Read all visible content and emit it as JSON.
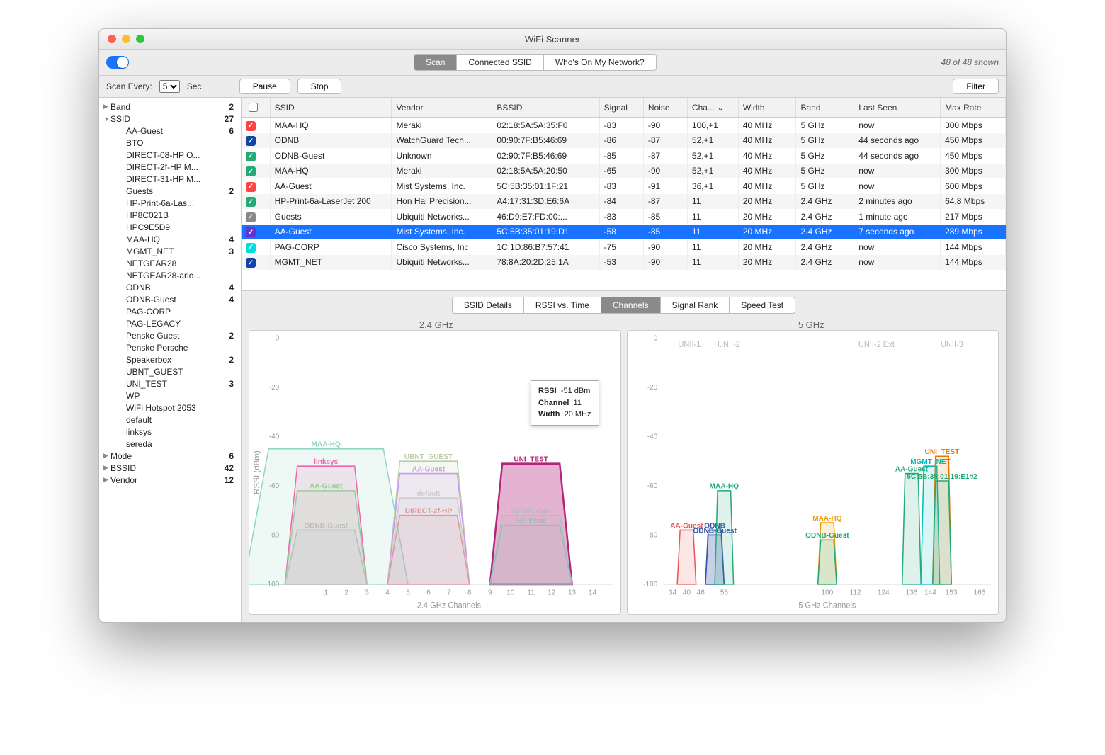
{
  "window": {
    "title": "WiFi Scanner"
  },
  "toolbar": {
    "tabs": [
      "Scan",
      "Connected SSID",
      "Who's On My Network?"
    ],
    "active_tab": 0,
    "shown_text": "48 of 48 shown"
  },
  "controls": {
    "scan_every_label": "Scan Every:",
    "scan_every_value": "5",
    "sec_label": "Sec.",
    "pause": "Pause",
    "stop": "Stop",
    "filter": "Filter"
  },
  "sidebar": {
    "groups": [
      {
        "tri": "▶",
        "name": "Band",
        "count": "2"
      },
      {
        "tri": "▼",
        "name": "SSID",
        "count": "27"
      }
    ],
    "ssids": [
      {
        "name": "AA-Guest",
        "count": "6"
      },
      {
        "name": "BTO",
        "count": ""
      },
      {
        "name": "DIRECT-08-HP O...",
        "count": ""
      },
      {
        "name": "DIRECT-2f-HP M...",
        "count": ""
      },
      {
        "name": "DIRECT-31-HP M...",
        "count": ""
      },
      {
        "name": "Guests",
        "count": "2"
      },
      {
        "name": "HP-Print-6a-Las...",
        "count": ""
      },
      {
        "name": "HP8C021B",
        "count": ""
      },
      {
        "name": "HPC9E5D9",
        "count": ""
      },
      {
        "name": "MAA-HQ",
        "count": "4"
      },
      {
        "name": "MGMT_NET",
        "count": "3"
      },
      {
        "name": "NETGEAR28",
        "count": ""
      },
      {
        "name": "NETGEAR28-arlo...",
        "count": ""
      },
      {
        "name": "ODNB",
        "count": "4"
      },
      {
        "name": "ODNB-Guest",
        "count": "4"
      },
      {
        "name": "PAG-CORP",
        "count": ""
      },
      {
        "name": "PAG-LEGACY",
        "count": ""
      },
      {
        "name": "Penske Guest",
        "count": "2"
      },
      {
        "name": "Penske Porsche",
        "count": ""
      },
      {
        "name": "Speakerbox",
        "count": "2"
      },
      {
        "name": "UBNT_GUEST",
        "count": ""
      },
      {
        "name": "UNI_TEST",
        "count": "3"
      },
      {
        "name": "WP",
        "count": ""
      },
      {
        "name": "WiFi Hotspot 2053",
        "count": ""
      },
      {
        "name": "default",
        "count": ""
      },
      {
        "name": "linksys",
        "count": ""
      },
      {
        "name": "sereda",
        "count": ""
      }
    ],
    "footer_groups": [
      {
        "tri": "▶",
        "name": "Mode",
        "count": "6"
      },
      {
        "tri": "▶",
        "name": "BSSID",
        "count": "42"
      },
      {
        "tri": "▶",
        "name": "Vendor",
        "count": "12"
      }
    ]
  },
  "table": {
    "headers": [
      "",
      "SSID",
      "Vendor",
      "BSSID",
      "Signal",
      "Noise",
      "Cha... ⌄",
      "Width",
      "Band",
      "Last Seen",
      "Max Rate"
    ],
    "rows": [
      {
        "color": "#f44",
        "ssid": "MAA-HQ",
        "vendor": "Meraki",
        "bssid": "02:18:5A:5A:35:F0",
        "sig": "-83",
        "noise": "-90",
        "ch": "100,+1",
        "w": "40 MHz",
        "band": "5 GHz",
        "last": "now",
        "rate": "300 Mbps"
      },
      {
        "color": "#14a",
        "ssid": "ODNB",
        "vendor": "WatchGuard Tech...",
        "bssid": "00:90:7F:B5:46:69",
        "sig": "-86",
        "noise": "-87",
        "ch": "52,+1",
        "w": "40 MHz",
        "band": "5 GHz",
        "last": "44 seconds ago",
        "rate": "450 Mbps"
      },
      {
        "color": "#2a7",
        "ssid": "ODNB-Guest",
        "vendor": "Unknown",
        "bssid": "02:90:7F:B5:46:69",
        "sig": "-85",
        "noise": "-87",
        "ch": "52,+1",
        "w": "40 MHz",
        "band": "5 GHz",
        "last": "44 seconds ago",
        "rate": "450 Mbps"
      },
      {
        "color": "#2a7",
        "ssid": "MAA-HQ",
        "vendor": "Meraki",
        "bssid": "02:18:5A:5A:20:50",
        "sig": "-65",
        "noise": "-90",
        "ch": "52,+1",
        "w": "40 MHz",
        "band": "5 GHz",
        "last": "now",
        "rate": "300 Mbps"
      },
      {
        "color": "#f44",
        "ssid": "AA-Guest",
        "vendor": "Mist Systems, Inc.",
        "bssid": "5C:5B:35:01:1F:21",
        "sig": "-83",
        "noise": "-91",
        "ch": "36,+1",
        "w": "40 MHz",
        "band": "5 GHz",
        "last": "now",
        "rate": "600 Mbps"
      },
      {
        "color": "#2a7",
        "ssid": "HP-Print-6a-LaserJet 200",
        "vendor": "Hon Hai Precision...",
        "bssid": "A4:17:31:3D:E6:6A",
        "sig": "-84",
        "noise": "-87",
        "ch": "11",
        "w": "20 MHz",
        "band": "2.4 GHz",
        "last": "2 minutes ago",
        "rate": "64.8 Mbps"
      },
      {
        "color": "#888",
        "ssid": "Guests",
        "vendor": "Ubiquiti Networks...",
        "bssid": "46:D9:E7:FD:00:...",
        "sig": "-83",
        "noise": "-85",
        "ch": "11",
        "w": "20 MHz",
        "band": "2.4 GHz",
        "last": "1 minute ago",
        "rate": "217 Mbps"
      },
      {
        "color": "#63c",
        "sel": true,
        "ssid": "AA-Guest",
        "vendor": "Mist Systems, Inc.",
        "bssid": "5C:5B:35:01:19:D1",
        "sig": "-58",
        "noise": "-85",
        "ch": "11",
        "w": "20 MHz",
        "band": "2.4 GHz",
        "last": "7 seconds ago",
        "rate": "289 Mbps"
      },
      {
        "color": "#0dd",
        "ssid": "PAG-CORP",
        "vendor": "Cisco Systems, Inc",
        "bssid": "1C:1D:86:B7:57:41",
        "sig": "-75",
        "noise": "-90",
        "ch": "11",
        "w": "20 MHz",
        "band": "2.4 GHz",
        "last": "now",
        "rate": "144 Mbps"
      },
      {
        "color": "#14a",
        "ssid": "MGMT_NET",
        "vendor": "Ubiquiti Networks...",
        "bssid": "78:8A:20:2D:25:1A",
        "sig": "-53",
        "noise": "-90",
        "ch": "11",
        "w": "20 MHz",
        "band": "2.4 GHz",
        "last": "now",
        "rate": "144 Mbps"
      }
    ]
  },
  "detail_tabs": {
    "items": [
      "SSID Details",
      "RSSI vs. Time",
      "Channels",
      "Signal Rank",
      "Speed Test"
    ],
    "active": 2
  },
  "charts_titles": {
    "left": "2.4 GHz",
    "right": "5 GHz"
  },
  "tooltip": {
    "rssi_lbl": "RSSI",
    "rssi": "-51 dBm",
    "ch_lbl": "Channel",
    "ch": "11",
    "w_lbl": "Width",
    "w": "20 MHz"
  },
  "chart_data": {
    "left": {
      "type": "area",
      "xlabel": "2.4 GHz Channels",
      "ylabel": "RSSI (dBm)",
      "ylim": [
        -100,
        0
      ],
      "xticks": [
        1,
        2,
        3,
        4,
        5,
        6,
        7,
        8,
        9,
        10,
        11,
        12,
        13,
        14
      ],
      "networks": [
        {
          "name": "MAA-HQ",
          "ch": 1,
          "rssi": -45,
          "width": 40,
          "color": "#8fd6c4"
        },
        {
          "name": "linksys",
          "ch": 1,
          "rssi": -52,
          "width": 20,
          "color": "#e6a"
        },
        {
          "name": "AA-Guest",
          "ch": 1,
          "rssi": -62,
          "width": 20,
          "color": "#9c9"
        },
        {
          "name": "ODNB-Guest",
          "ch": 1,
          "rssi": -78,
          "width": 20,
          "color": "#bbb"
        },
        {
          "name": "UBNT_GUEST",
          "ch": 6,
          "rssi": -50,
          "width": 20,
          "color": "#bca"
        },
        {
          "name": "AA-Guest",
          "ch": 6,
          "rssi": -55,
          "width": 20,
          "color": "#c9e"
        },
        {
          "name": "default",
          "ch": 6,
          "rssi": -65,
          "width": 20,
          "color": "#ccc"
        },
        {
          "name": "DIRECT-2f-HP",
          "ch": 6,
          "rssi": -72,
          "width": 20,
          "color": "#d99"
        },
        {
          "name": "UNI_TEST",
          "ch": 11,
          "rssi": -51,
          "width": 20,
          "color": "#b1257a",
          "bold": true
        },
        {
          "name": "Speakerbox",
          "ch": 11,
          "rssi": -72,
          "width": 20,
          "color": "#bbb"
        },
        {
          "name": "HP-Print",
          "ch": 11,
          "rssi": -76,
          "width": 20,
          "color": "#9bb"
        }
      ]
    },
    "right": {
      "type": "area",
      "xlabel": "5 GHz Channels",
      "ylabel": "",
      "ylim": [
        -100,
        0
      ],
      "xticks": [
        34,
        40,
        46,
        56,
        100,
        112,
        124,
        136,
        144,
        153,
        165
      ],
      "band_labels": [
        "UNII-1",
        "UNII-2",
        "UNII-2 Ext",
        "UNII-3"
      ],
      "networks": [
        {
          "name": "AA-Guest",
          "ch": 40,
          "rssi": -78,
          "width": 40,
          "color": "#e55"
        },
        {
          "name": "ODNB",
          "ch": 52,
          "rssi": -78,
          "width": 40,
          "color": "#35a"
        },
        {
          "name": "ODNB-Guest",
          "ch": 52,
          "rssi": -80,
          "width": 40,
          "color": "#35a"
        },
        {
          "name": "MAA-HQ",
          "ch": 56,
          "rssi": -62,
          "width": 40,
          "color": "#2a7"
        },
        {
          "name": "MAA-HQ",
          "ch": 100,
          "rssi": -75,
          "width": 40,
          "color": "#e90"
        },
        {
          "name": "ODNB-Guest",
          "ch": 100,
          "rssi": -82,
          "width": 40,
          "color": "#2a7"
        },
        {
          "name": "AA-Guest",
          "ch": 136,
          "rssi": -55,
          "width": 40,
          "color": "#2a7"
        },
        {
          "name": "MGMT_NET",
          "ch": 144,
          "rssi": -52,
          "width": 40,
          "color": "#0bb"
        },
        {
          "name": "UNI_TEST",
          "ch": 149,
          "rssi": -48,
          "width": 40,
          "color": "#e70"
        },
        {
          "name": "5C:5B:35:01:19:E1#2",
          "ch": 149,
          "rssi": -58,
          "width": 40,
          "color": "#2a7"
        }
      ]
    }
  }
}
